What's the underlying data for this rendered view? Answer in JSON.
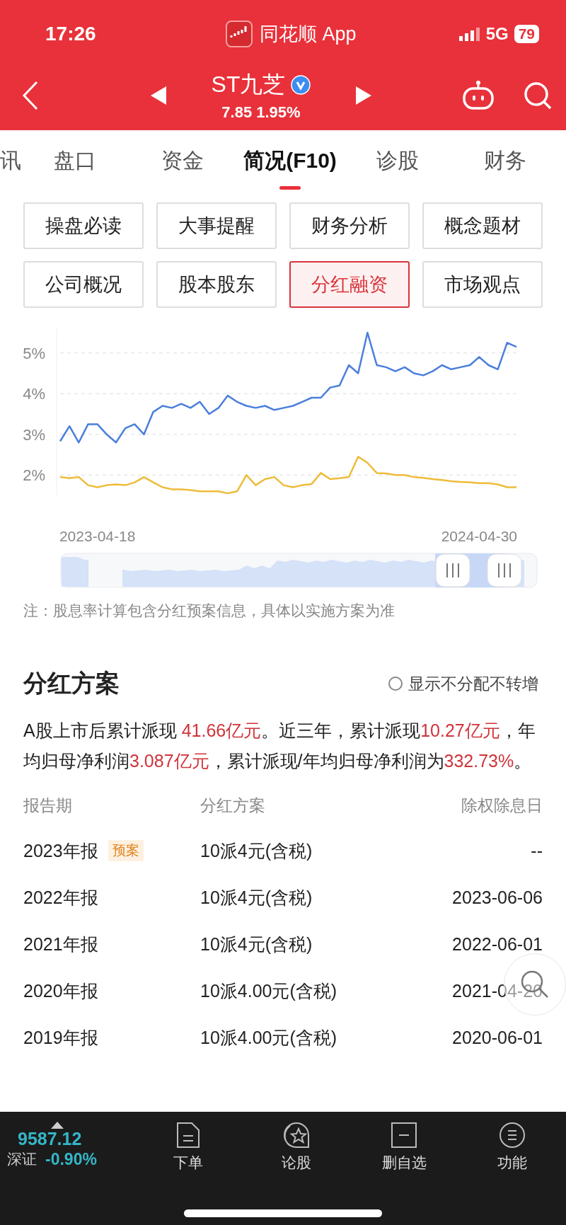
{
  "status_bar": {
    "time": "17:26",
    "app": "同花顺 App",
    "network": "5G",
    "battery": "79"
  },
  "header": {
    "title": "ST九芝",
    "verified": true,
    "price": "7.85",
    "change": "1.95%"
  },
  "tabs": [
    {
      "label": "讯",
      "selected": false
    },
    {
      "label": "盘口",
      "selected": false
    },
    {
      "label": "资金",
      "selected": false
    },
    {
      "label": "简况(F10)",
      "selected": true
    },
    {
      "label": "诊股",
      "selected": false
    },
    {
      "label": "财务",
      "selected": false
    }
  ],
  "shortcuts": [
    {
      "label": "操盘必读",
      "selected": false
    },
    {
      "label": "大事提醒",
      "selected": false
    },
    {
      "label": "财务分析",
      "selected": false
    },
    {
      "label": "概念题材",
      "selected": false
    },
    {
      "label": "公司概况",
      "selected": false
    },
    {
      "label": "股本股东",
      "selected": false
    },
    {
      "label": "分红融资",
      "selected": true
    },
    {
      "label": "市场观点",
      "selected": false
    }
  ],
  "chart": {
    "chart_data": {
      "type": "line",
      "categories": [
        null,
        null,
        null,
        null,
        "2023-04-18",
        null,
        null,
        null,
        null,
        null,
        null,
        null,
        null,
        null,
        null,
        null,
        null,
        null,
        null,
        null,
        null,
        null,
        null,
        null,
        null,
        null,
        null,
        null,
        null,
        null,
        null,
        null,
        null,
        null,
        null,
        null,
        null,
        null,
        null,
        null,
        null,
        null,
        null,
        null,
        null,
        "2024-04-30",
        null,
        null,
        null,
        null
      ],
      "series": [
        {
          "color": "#4a7fdc",
          "values": [
            2.83,
            3.2,
            2.8,
            3.25,
            3.25,
            3.0,
            2.8,
            3.15,
            3.25,
            3.0,
            3.55,
            3.7,
            3.65,
            3.75,
            3.65,
            3.8,
            3.5,
            3.65,
            3.95,
            3.8,
            3.7,
            3.65,
            3.7,
            3.6,
            3.65,
            3.7,
            3.8,
            3.9,
            3.9,
            4.15,
            4.2,
            4.7,
            4.5,
            5.5,
            4.7,
            4.65,
            4.55,
            4.65,
            4.5,
            4.45,
            4.55,
            4.7,
            4.6,
            4.65,
            4.7,
            4.9,
            4.7,
            4.6,
            5.25,
            5.15
          ]
        },
        {
          "color": "#eebc3a",
          "values": [
            1.95,
            1.92,
            1.95,
            1.75,
            1.7,
            1.75,
            1.77,
            1.75,
            1.82,
            1.95,
            1.82,
            1.7,
            1.65,
            1.65,
            1.63,
            1.6,
            1.6,
            1.6,
            1.55,
            1.6,
            2.0,
            1.75,
            1.9,
            1.95,
            1.75,
            1.7,
            1.75,
            1.78,
            2.05,
            1.9,
            1.92,
            1.95,
            2.45,
            2.3,
            2.05,
            2.04,
            2.0,
            2.0,
            1.95,
            1.93,
            1.9,
            1.88,
            1.85,
            1.83,
            1.82,
            1.8,
            1.8,
            1.77,
            1.7,
            1.7
          ]
        }
      ],
      "grid": true,
      "ylim": [
        1.5,
        5.6
      ],
      "yticks": [
        {
          "value": 2,
          "label": "2%"
        },
        {
          "value": 3,
          "label": "3%"
        },
        {
          "value": 4,
          "label": "4%"
        },
        {
          "value": 5,
          "label": "5%"
        }
      ]
    }
  },
  "note": "注：股息率计算包含分红预案信息，具体以实施方案为准",
  "dividend": {
    "title": "分红方案",
    "filter": {
      "label": "显示不分配不转增",
      "checked": false
    },
    "summary": [
      {
        "text": "A股上市后累计派现 ",
        "highlight": false
      },
      {
        "text": "41.66亿元",
        "highlight": true
      },
      {
        "text": "。近三年，累计派现",
        "highlight": false
      },
      {
        "text": "10.27亿元",
        "highlight": true
      },
      {
        "text": "，年均归母净利润",
        "highlight": false
      },
      {
        "text": "3.087亿元",
        "highlight": true
      },
      {
        "text": "，累计派现/年均归母净利润为",
        "highlight": false
      },
      {
        "text": "332.73%",
        "highlight": true
      },
      {
        "text": "。",
        "highlight": false
      }
    ],
    "columns": [
      "报告期",
      "分红方案",
      "除权除息日"
    ],
    "rows": [
      {
        "period": "2023年报",
        "tag": "预案",
        "plan": "10派4元(含税)",
        "ex_date": "--"
      },
      {
        "period": "2022年报",
        "plan": "10派4元(含税)",
        "ex_date": "2023-06-06"
      },
      {
        "period": "2021年报",
        "plan": "10派4元(含税)",
        "ex_date": "2022-06-01"
      },
      {
        "period": "2020年报",
        "plan": "10派4.00元(含税)",
        "ex_date": "2021-04-20"
      },
      {
        "period": "2019年报",
        "plan": "10派4.00元(含税)",
        "ex_date": "2020-06-01"
      }
    ]
  },
  "bottom_bar": {
    "index": {
      "value": "9587.12",
      "name": "深证",
      "change": "-0.90%"
    },
    "actions": [
      {
        "label": "下单",
        "kind": "order"
      },
      {
        "label": "论股",
        "kind": "discuss"
      },
      {
        "label": "删自选",
        "kind": "remove"
      },
      {
        "label": "功能",
        "kind": "menu"
      }
    ]
  }
}
